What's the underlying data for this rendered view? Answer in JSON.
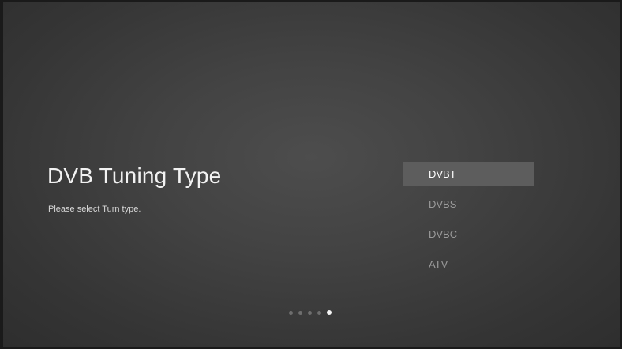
{
  "setup": {
    "title": "DVB Tuning Type",
    "subtitle": "Please select Turn type."
  },
  "tuning_options": [
    {
      "label": "DVBT",
      "selected": true
    },
    {
      "label": "DVBS",
      "selected": false
    },
    {
      "label": "DVBC",
      "selected": false
    },
    {
      "label": "ATV",
      "selected": false
    }
  ],
  "page_indicator": {
    "total_steps": 5,
    "current_step": 5
  },
  "colors": {
    "background_center": "#4d4d4d",
    "background_edge": "#2e2e2e",
    "selected_item_bg": "#5d5d5d",
    "selected_text": "#ffffff",
    "unselected_text": "#9a9a9a"
  }
}
